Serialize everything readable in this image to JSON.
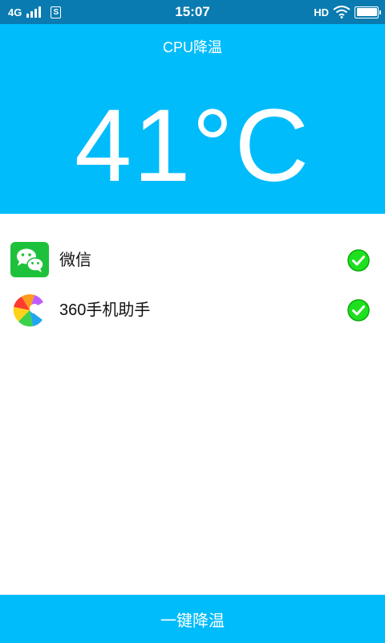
{
  "status_bar": {
    "network": "4G",
    "time": "15:07",
    "hd": "HD",
    "sim_icon": "S",
    "battery_level": 1.0
  },
  "header": {
    "title": "CPU降温",
    "temperature": "41°C",
    "background_color": "#00bcfb"
  },
  "apps": [
    {
      "name": "微信",
      "icon": "wechat-icon",
      "checked": true
    },
    {
      "name": "360手机助手",
      "icon": "360-assistant-icon",
      "checked": true
    }
  ],
  "action": {
    "label": "一键降温"
  },
  "colors": {
    "accent": "#00bcfb",
    "status_bar": "#0a7bb0",
    "check": "#1ee01e"
  }
}
